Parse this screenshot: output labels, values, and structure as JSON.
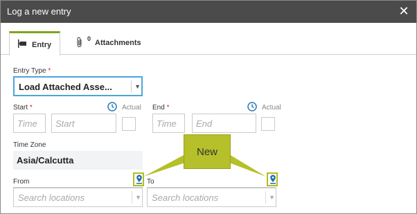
{
  "dialog": {
    "title": "Log a new entry",
    "close_icon": "close-icon"
  },
  "tabs": [
    {
      "label": "Entry",
      "icon": "entry-icon",
      "selected": true
    },
    {
      "label": "Attachments",
      "icon": "paperclip-icon",
      "count": "0",
      "selected": false
    }
  ],
  "entry_type": {
    "label": "Entry Type",
    "required_mark": "*",
    "value": "Load Attached Asse..."
  },
  "start": {
    "label": "Start",
    "required_mark": "*",
    "time_placeholder": "Time",
    "date_placeholder": "Start",
    "actual_label": "Actual"
  },
  "end": {
    "label": "End",
    "required_mark": "*",
    "time_placeholder": "Time",
    "date_placeholder": "End",
    "actual_label": "Actual"
  },
  "time_zone": {
    "label": "Time Zone",
    "value": "Asia/Calcutta"
  },
  "from": {
    "label": "From",
    "placeholder": "Search locations"
  },
  "to": {
    "label": "To",
    "placeholder": "Search locations"
  },
  "callout": {
    "text": "New"
  },
  "colors": {
    "titlebar": "#4b4b4b",
    "accent_blue": "#4aa6d9",
    "callout": "#b5c02a",
    "tab_accent": "#7fa61c",
    "required": "#dd2222"
  }
}
